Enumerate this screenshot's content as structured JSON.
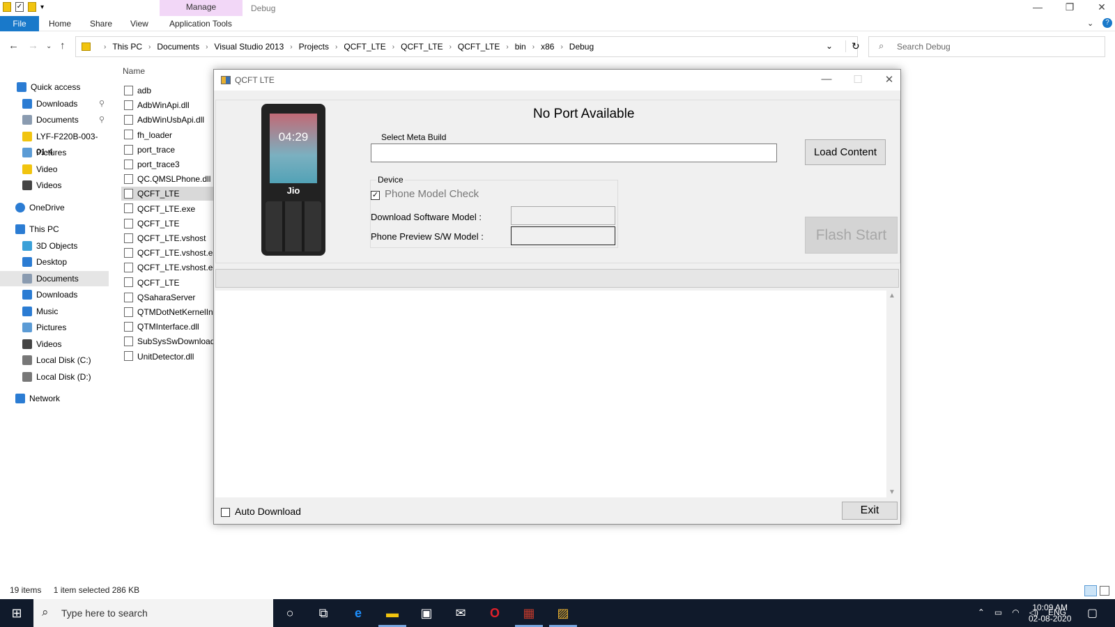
{
  "explorer": {
    "manage_label": "Manage",
    "window_title": "Debug",
    "tabs": {
      "file": "File",
      "home": "Home",
      "share": "Share",
      "view": "View",
      "app_tools": "Application Tools"
    },
    "breadcrumbs": [
      "This PC",
      "Documents",
      "Visual Studio 2013",
      "Projects",
      "QCFT_LTE",
      "QCFT_LTE",
      "QCFT_LTE",
      "bin",
      "x86",
      "Debug"
    ],
    "search_placeholder": "Search Debug",
    "nav": [
      {
        "label": "Quick access",
        "icon": "star-icon"
      },
      {
        "label": "Downloads",
        "icon": "download-icon"
      },
      {
        "label": "Documents",
        "icon": "document-icon"
      },
      {
        "label": "LYF-F220B-003-01-4",
        "icon": "folder-icon"
      },
      {
        "label": "Pictures",
        "icon": "pictures-icon"
      },
      {
        "label": "Video",
        "icon": "folder-icon"
      },
      {
        "label": "Videos",
        "icon": "videos-icon"
      },
      {
        "label": "OneDrive",
        "icon": "cloud-icon"
      },
      {
        "label": "This PC",
        "icon": "pc-icon"
      },
      {
        "label": "3D Objects",
        "icon": "cube-icon"
      },
      {
        "label": "Desktop",
        "icon": "desktop-icon"
      },
      {
        "label": "Documents",
        "icon": "document-icon"
      },
      {
        "label": "Downloads",
        "icon": "download-icon"
      },
      {
        "label": "Music",
        "icon": "music-icon"
      },
      {
        "label": "Pictures",
        "icon": "pictures-icon"
      },
      {
        "label": "Videos",
        "icon": "videos-icon"
      },
      {
        "label": "Local Disk (C:)",
        "icon": "disk-icon"
      },
      {
        "label": "Local Disk (D:)",
        "icon": "disk-icon"
      },
      {
        "label": "Network",
        "icon": "network-icon"
      }
    ],
    "column_name": "Name",
    "files": [
      "adb",
      "AdbWinApi.dll",
      "AdbWinUsbApi.dll",
      "fh_loader",
      "port_trace",
      "port_trace3",
      "QC.QMSLPhone.dll",
      "QCFT_LTE",
      "QCFT_LTE.exe",
      "QCFT_LTE",
      "QCFT_LTE.vshost",
      "QCFT_LTE.vshost.exe",
      "QCFT_LTE.vshost.exe",
      "QCFT_LTE",
      "QSaharaServer",
      "QTMDotNetKernelInt",
      "QTMInterface.dll",
      "SubSysSwDownload.",
      "UnitDetector.dll"
    ],
    "status_items": "19 items",
    "status_selected": "1 item selected  286 KB"
  },
  "dialog": {
    "title": "QCFT LTE",
    "phone_time": "04:29",
    "phone_brand": "Jio",
    "port_status": "No Port Available",
    "select_meta_label": "Select Meta  Build",
    "meta_value": "",
    "load_button": "Load Content",
    "device_group": "Device",
    "phone_model_check": "Phone Model Check",
    "phone_model_checked": true,
    "download_model_label": "Download  Software Model :",
    "download_model_value": "",
    "preview_model_label": "Phone Preview S/W Model :",
    "preview_model_value": "",
    "flash_button": "Flash Start",
    "auto_download": "Auto Download",
    "auto_download_checked": false,
    "exit_button": "Exit"
  },
  "taskbar": {
    "search_placeholder": "Type here to search",
    "language": "ENG",
    "time": "10:09 AM",
    "date": "02-08-2020"
  }
}
